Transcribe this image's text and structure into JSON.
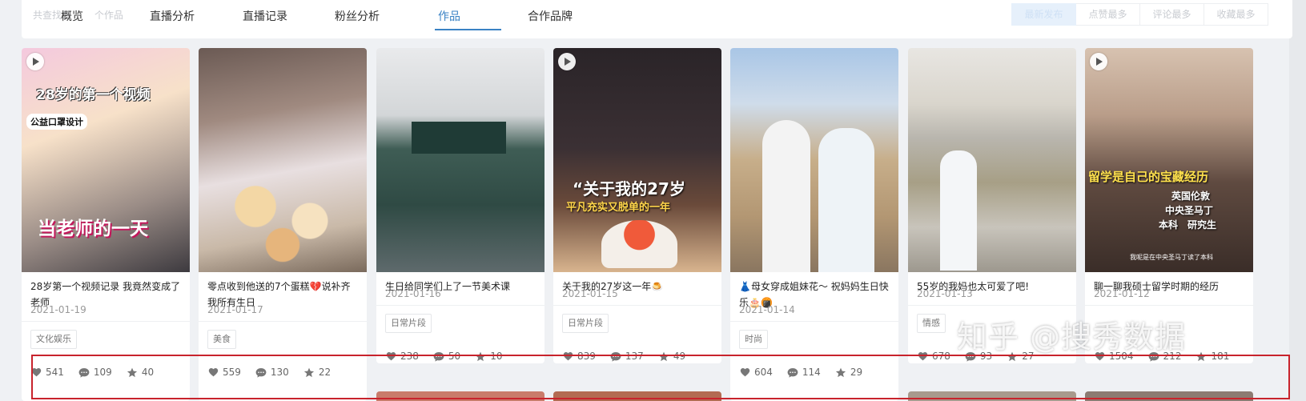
{
  "header": {
    "ghost_text_1": "共查找到",
    "ghost_text_2": "个作品",
    "tabs": [
      {
        "label": "概览"
      },
      {
        "label": "直播分析"
      },
      {
        "label": "直播记录"
      },
      {
        "label": "粉丝分析"
      },
      {
        "label": "作品",
        "active": true
      },
      {
        "label": "合作品牌"
      }
    ],
    "sort_buttons": [
      {
        "label": "最新发布",
        "active": true
      },
      {
        "label": "点赞最多"
      },
      {
        "label": "评论最多"
      },
      {
        "label": "收藏最多"
      }
    ]
  },
  "cards": [
    {
      "overlay_lines": [
        "28岁的第一个视频",
        "公益口罩设计",
        "当老师的一天"
      ],
      "caption": "28岁第一个视频记录 我竟然变成了老师",
      "date": "2021-01-19",
      "tag": "文化娱乐",
      "likes": "541",
      "comments": "109",
      "favorites": "40"
    },
    {
      "overlay_lines": [],
      "caption": "零点收到他送的7个蛋糕💔说补齐我所有生日",
      "date": "2021-01-17",
      "tag": "美食",
      "likes": "559",
      "comments": "130",
      "favorites": "22"
    },
    {
      "overlay_lines": [],
      "caption": "生日给同学们上了一节美术课",
      "date": "2021-01-16",
      "tag": "日常片段",
      "likes": "238",
      "comments": "50",
      "favorites": "10"
    },
    {
      "overlay_lines": [
        "“关于我的27岁",
        "平凡充实又脱单的一年"
      ],
      "caption": "关于我的27岁这一年🍮",
      "date": "2021-01-15",
      "tag": "日常片段",
      "likes": "839",
      "comments": "137",
      "favorites": "49"
    },
    {
      "overlay_lines": [],
      "caption": "👗母女穿成姐妹花～ 祝妈妈生日快乐🎂🍘",
      "date": "2021-01-14",
      "tag": "时尚",
      "likes": "604",
      "comments": "114",
      "favorites": "29"
    },
    {
      "overlay_lines": [],
      "caption": "55岁的我妈也太可爱了吧!",
      "date": "2021-01-13",
      "tag": "情感",
      "likes": "678",
      "comments": "93",
      "favorites": "27"
    },
    {
      "overlay_lines": [
        "留学是自己的宝藏经历",
        "英国伦敦",
        "中央圣马丁",
        "本科　研究生",
        "我呢是在中央圣马丁读了本科"
      ],
      "caption": "聊一聊我硕士留学时期的经历",
      "date": "2021-01-12",
      "tag": "",
      "likes": "1504",
      "comments": "212",
      "favorites": "181"
    }
  ],
  "watermark": "知乎 @搜秀数据",
  "colors": {
    "accent": "#3a82c4",
    "annotation": "#c8232c",
    "background": "#eff1f4"
  },
  "icons": [
    "heart-icon",
    "comment-icon",
    "star-icon",
    "play-icon"
  ]
}
